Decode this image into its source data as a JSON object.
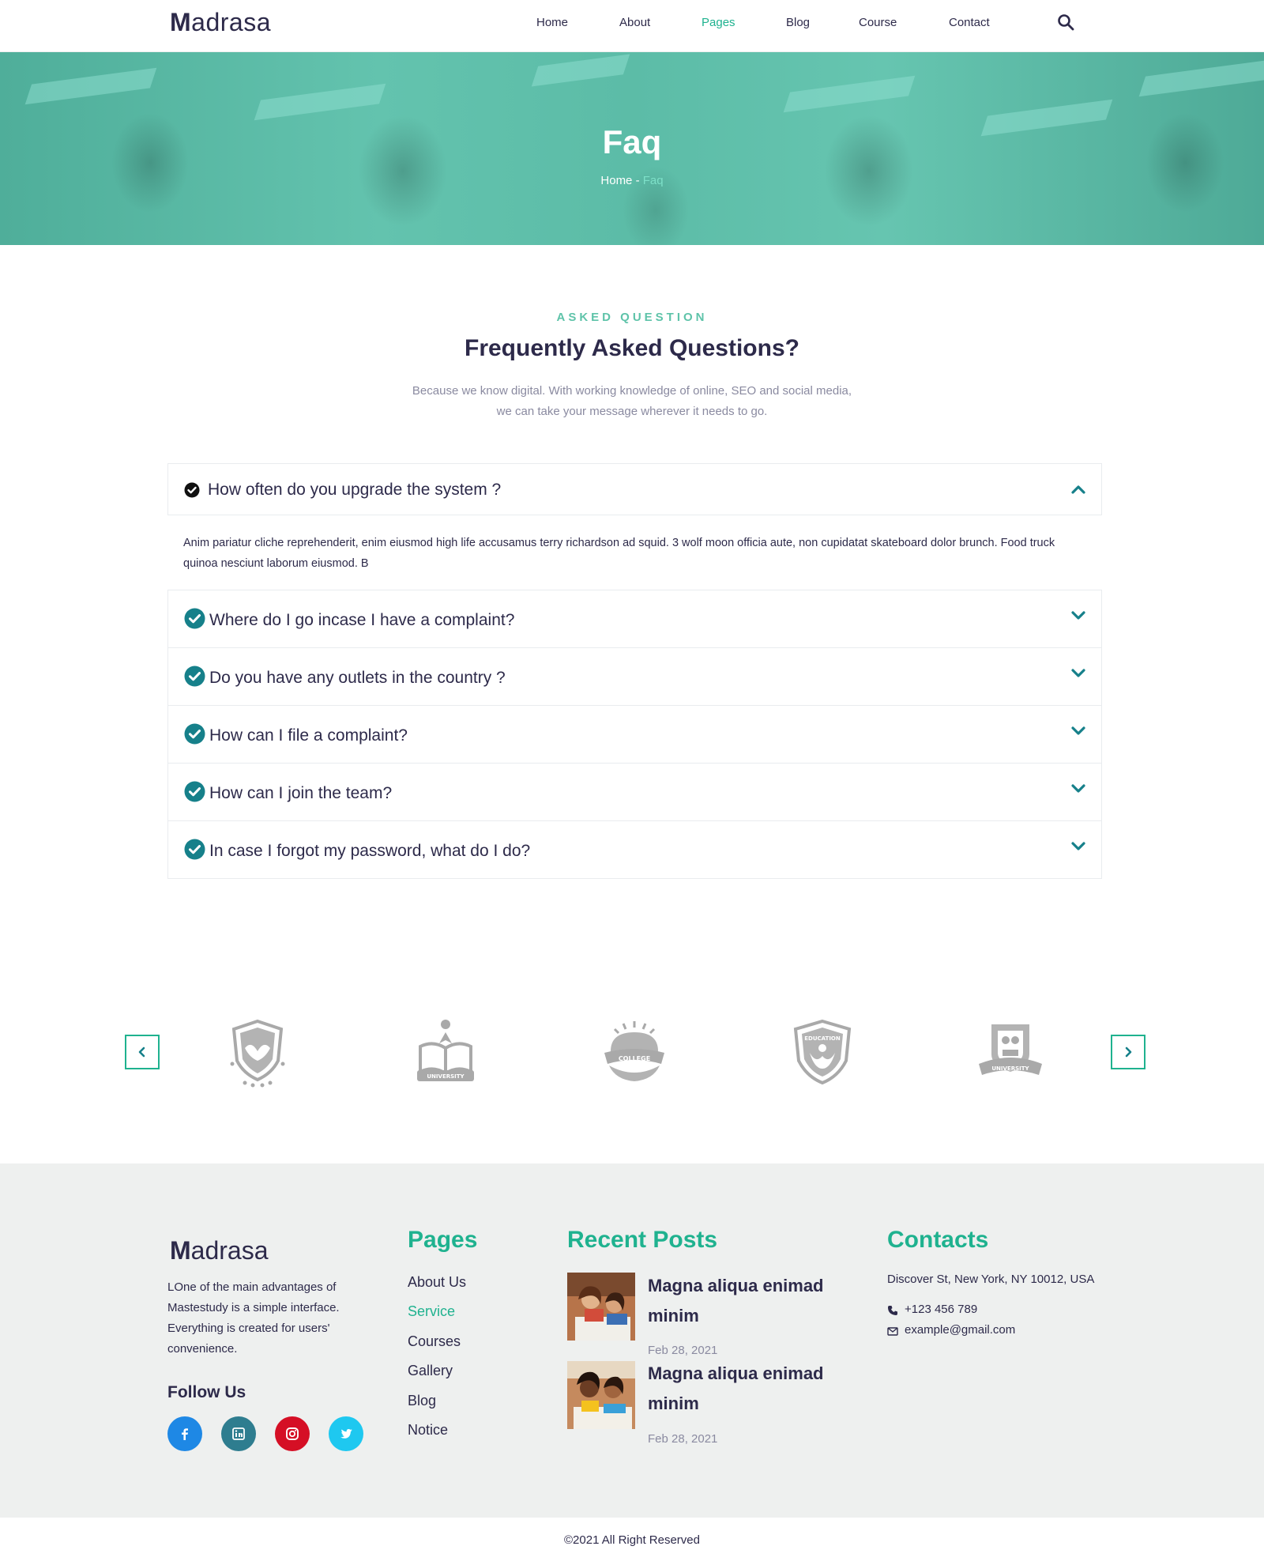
{
  "header": {
    "logo": {
      "first": "M",
      "rest": "adrasa"
    },
    "nav": [
      {
        "label": "Home",
        "active": false
      },
      {
        "label": "About",
        "active": false
      },
      {
        "label": "Pages",
        "active": true
      },
      {
        "label": "Blog",
        "active": false
      },
      {
        "label": "Course",
        "active": false
      },
      {
        "label": "Contact",
        "active": false
      }
    ],
    "search_icon": "search-icon"
  },
  "hero": {
    "title": "Faq",
    "breadcrumb": {
      "home": "Home",
      "separator": " - ",
      "current": "Faq"
    }
  },
  "faq_section": {
    "kicker": "ASKED QUESTION",
    "title": "Frequently Asked Questions?",
    "description_lines": [
      "Because we know digital. With working knowledge of online, SEO and social media,",
      "we can take your message wherever it needs to go."
    ],
    "items": [
      {
        "question": "How often do you upgrade the system ?",
        "expanded": true,
        "answer": "Anim pariatur cliche reprehenderit, enim eiusmod high life accusamus terry richardson ad squid. 3 wolf moon officia aute, non cupidatat skateboard dolor brunch. Food truck quinoa nesciunt laborum eiusmod. B"
      },
      {
        "question": "Where do I go incase I have a complaint?",
        "expanded": false
      },
      {
        "question": "Do you have any outlets in the country ?",
        "expanded": false
      },
      {
        "question": "How can I file a complaint?",
        "expanded": false
      },
      {
        "question": "How can I join the team?",
        "expanded": false
      },
      {
        "question": "In case I forgot my password, what do I do?",
        "expanded": false
      }
    ]
  },
  "brands": {
    "prev_icon": "chevron-left-icon",
    "next_icon": "chevron-right-icon",
    "logos": [
      {
        "icon": "shield-hands-logo",
        "text": ""
      },
      {
        "icon": "university-book-logo",
        "text": "UNIVERSITY"
      },
      {
        "icon": "college-sun-logo",
        "text": "COLLEGE"
      },
      {
        "icon": "education-shield-logo",
        "text": "EDUCATION"
      },
      {
        "icon": "university-crest-logo",
        "text": "UNIVERSITY"
      }
    ]
  },
  "footer": {
    "logo": {
      "first": "M",
      "rest": "adrasa"
    },
    "about": "LOne of the main advantages of Mastestudy is a simple interface. Everything is created for users' convenience.",
    "follow_title": "Follow Us",
    "social": [
      {
        "name": "facebook",
        "icon": "facebook-icon",
        "color": "#1e88e5"
      },
      {
        "name": "linkedin",
        "icon": "linkedin-icon",
        "color": "#2e7d8f"
      },
      {
        "name": "instagram",
        "icon": "instagram-icon",
        "color": "#d50f25"
      },
      {
        "name": "twitter",
        "icon": "twitter-icon",
        "color": "#1ec8f0"
      }
    ],
    "pages_title": "Pages",
    "pages": [
      {
        "label": "About Us",
        "active": false
      },
      {
        "label": "Service",
        "active": true
      },
      {
        "label": "Courses",
        "active": false
      },
      {
        "label": "Gallery",
        "active": false
      },
      {
        "label": "Blog",
        "active": false
      },
      {
        "label": "Notice",
        "active": false
      }
    ],
    "posts_title": "Recent Posts",
    "posts": [
      {
        "title_lines": [
          "Magna aliqua enimad",
          "minim"
        ],
        "date": "Feb 28, 2021"
      },
      {
        "title_lines": [
          "Magna aliqua enimad",
          "minim"
        ],
        "date": "Feb 28, 2021"
      }
    ],
    "contacts_title": "Contacts",
    "address": "Discover St, New York, NY 10012, USA",
    "phone": "+123 456 789",
    "email": "example@gmail.com"
  },
  "copyright": "©2021 All Right Reserved",
  "colors": {
    "accent": "#1fb28f",
    "dark": "#2d2a4a",
    "icon_teal": "#16808a",
    "muted": "#8a8aa0",
    "footer_bg": "#eef0ef"
  }
}
